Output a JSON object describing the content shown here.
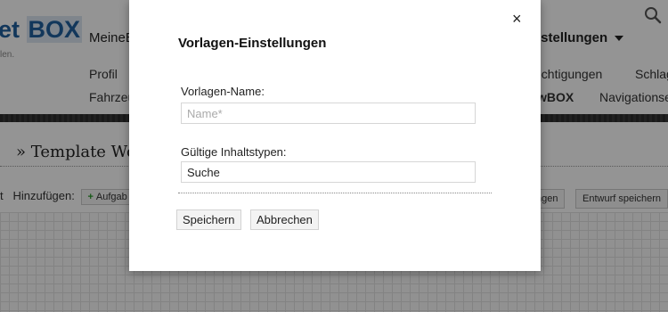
{
  "app": {
    "logo_text": "et ",
    "logo_box": "BOX",
    "logo_sub": "len."
  },
  "nav": {
    "top_left": "MeineB",
    "top_right": "nstellungen",
    "sub_row1_left": "Profil",
    "sub_row1_right": "echtigungen",
    "sub_row1_far": "Schlag",
    "sub_row2_left": "Fahrzeu",
    "sub_row2_right": "wBOX",
    "sub_row2_far": "Navigationse"
  },
  "page": {
    "title": "» Template Wor"
  },
  "toolbar": {
    "left_cut": "t",
    "add_label": "Hinzufügen:",
    "add_button": "Aufgab",
    "right_cut_button": "ngen",
    "draft_button": "Entwurf speichern"
  },
  "modal": {
    "title": "Vorlagen-Einstellungen",
    "close_symbol": "×",
    "name_label": "Vorlagen-Name:",
    "name_placeholder": "Name*",
    "name_value": "",
    "types_label": "Gültige Inhaltstypen:",
    "types_value": "Suche",
    "save_button": "Speichern",
    "cancel_button": "Abbrechen"
  },
  "colors": {
    "brand": "#1f5f9e",
    "overlay": "rgba(0,0,0,0.42)",
    "add_icon": "#2a9a2a"
  },
  "icons": {
    "search": "search-icon",
    "close": "close-icon",
    "add": "plus-icon",
    "dropdown": "chevron-down-icon"
  }
}
